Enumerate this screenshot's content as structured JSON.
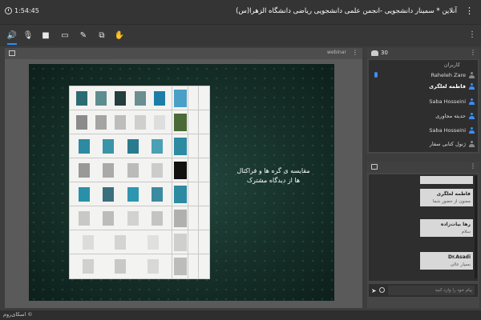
{
  "header": {
    "time": "1:54:45",
    "title": "آنلاین * سمینار دانشجویی -انجمن علمی دانشجویی ریاضی دانشگاه الزهرا(س)",
    "menu_glyph": "⋮"
  },
  "toolbar": {
    "tools": [
      {
        "name": "audio-icon",
        "glyph": "🔊",
        "active": true
      },
      {
        "name": "mic-muted-icon",
        "glyph": "🎙"
      },
      {
        "name": "camera-icon",
        "glyph": "■"
      },
      {
        "name": "screen-share-icon",
        "glyph": "▭"
      },
      {
        "name": "draw-icon",
        "glyph": "✎"
      },
      {
        "name": "presentation-icon",
        "glyph": "⧉"
      },
      {
        "name": "raise-hand-icon",
        "glyph": "✋"
      }
    ],
    "more_glyph": "⋮"
  },
  "presentation": {
    "tag": "webinar",
    "menu_glyph": "⋮",
    "slide_text": "مقایسه ی گره ها و فراکتال ها از دیدگاه مشترک"
  },
  "users": {
    "count": "30",
    "section_label": "کاربران",
    "menu_glyph": "⋮",
    "list": [
      {
        "name": "Raheleh Zare",
        "bold": false,
        "icon": "grey"
      },
      {
        "name": "فاطمه لعلگری",
        "bold": true,
        "icon": "blue"
      },
      {
        "name": "Saba Hosseini",
        "bold": false,
        "icon": "blue"
      },
      {
        "name": "حدیثه مجاوری",
        "bold": false,
        "icon": "blue"
      },
      {
        "name": "Saba Hosseini",
        "bold": false,
        "icon": "blue"
      },
      {
        "name": "ژنول کتابی سفار",
        "bold": false,
        "icon": "grey"
      }
    ]
  },
  "chat": {
    "menu_glyph": "⋮",
    "messages": [
      {
        "name": "فاطمه لعلگری",
        "text": "ممنون از حضور شما"
      },
      {
        "name": "رها بیات‌زاده",
        "text": "سلام"
      },
      {
        "name": "Dr.Asadi",
        "text": "بسیار عالی"
      }
    ],
    "input_placeholder": "پیام خود را وارد کنید",
    "send_glyph": "➤"
  },
  "footer": {
    "brand": "اسکای‌روم ©"
  }
}
